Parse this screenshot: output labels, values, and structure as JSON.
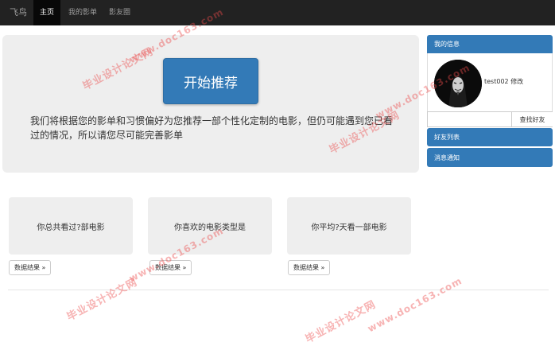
{
  "navbar": {
    "brand": "飞鸟",
    "items": [
      "主页",
      "我的影单",
      "影友圈"
    ],
    "active_index": 0
  },
  "jumbotron": {
    "button_label": "开始推荐",
    "lead_text": "我们将根据您的影单和习惯偏好为您推荐一部个性化定制的电影，但仍可能遇到您已看过的情况，所以请您尽可能完善影单"
  },
  "sidebar": {
    "info_title": "我的信息",
    "username": "test002",
    "edit_label": "修改",
    "search_placeholder": "",
    "search_button": "查找好友",
    "friends_title": "好友列表",
    "notify_title": "消息通知"
  },
  "cards": [
    {
      "text": "你总共看过?部电影",
      "button": "数据结果 »"
    },
    {
      "text": "你喜欢的电影类型是",
      "button": "数据结果 »"
    },
    {
      "text": "你平均?天看一部电影",
      "button": "数据结果 »"
    }
  ],
  "watermark": {
    "cn": "毕业设计论文网",
    "url": "www.doc163.com"
  },
  "colors": {
    "navbar_bg": "#222222",
    "primary": "#337ab7",
    "well_bg": "#eeeeee",
    "watermark": "#eb4b4b"
  }
}
